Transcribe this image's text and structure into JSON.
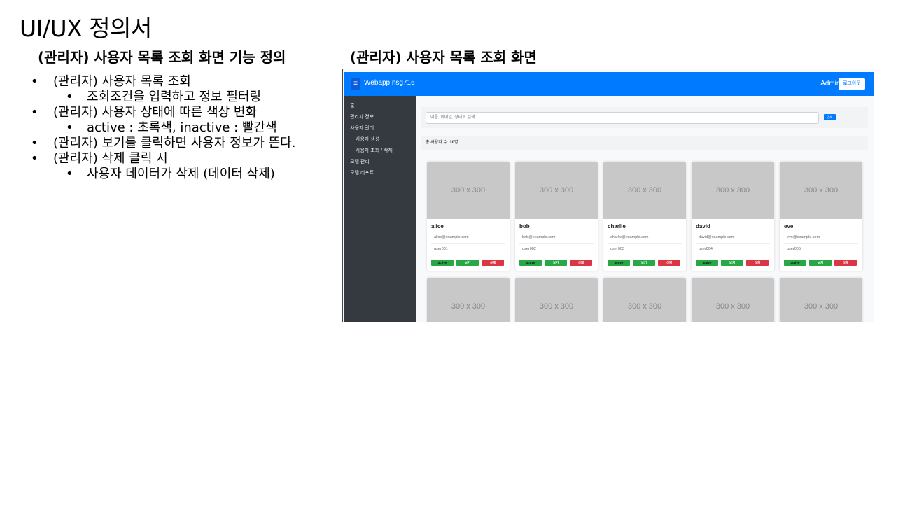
{
  "slide": {
    "title": "UI/UX 정의서",
    "left_heading": "(관리자) 사용자 목록 조회 화면 기능 정의",
    "right_heading": "(관리자) 사용자 목록 조회 화면"
  },
  "spec": [
    {
      "text": "(관리자) 사용자 목록 조회",
      "sub": [
        "조회조건을 입력하고 정보 필터링"
      ]
    },
    {
      "text": "(관리자) 사용자 상태에 따른 색상 변화",
      "sub": [
        "active : 초록색, inactive : 빨간색"
      ]
    },
    {
      "text": "(관리자) 보기를 클릭하면 사용자 정보가 뜬다.",
      "sub": []
    },
    {
      "text": "(관리자) 삭제 클릭 시",
      "sub": [
        "사용자 데이터가 삭제 (데이터 삭제)"
      ]
    }
  ],
  "app": {
    "menu_icon": "hamburger-icon",
    "brand": "Webapp nsg716",
    "admin_name": "Admin1",
    "logout_label": "로그아웃",
    "sidebar": [
      "홈",
      "관리자 정보",
      "사용자 관리",
      "사용자 생성",
      "사용자 조회 / 삭제",
      "모델 관리",
      "모델 리포트"
    ],
    "search_placeholder": "이름, 이메일, 상태로 검색...",
    "search_button": "검색",
    "count_label": "총 사용자 수: ",
    "count_value": "10",
    "count_unit": "명",
    "placeholder_image": "300 x 300",
    "users": [
      {
        "name": "alice",
        "email": "alice@example.com",
        "id": "user001",
        "status": "active"
      },
      {
        "name": "bob",
        "email": "bob@example.com",
        "id": "user002",
        "status": "active"
      },
      {
        "name": "charlie",
        "email": "charlie@example.com",
        "id": "user003",
        "status": "active"
      },
      {
        "name": "david",
        "email": "david@example.com",
        "id": "user004",
        "status": "active"
      },
      {
        "name": "eve",
        "email": "eve@example.com",
        "id": "user005",
        "status": "active"
      }
    ],
    "view_label": "보기",
    "delete_label": "삭제",
    "colors": {
      "primary": "#007bff",
      "sidebar": "#343a40",
      "active": "#28a745",
      "delete": "#dc3545"
    }
  }
}
